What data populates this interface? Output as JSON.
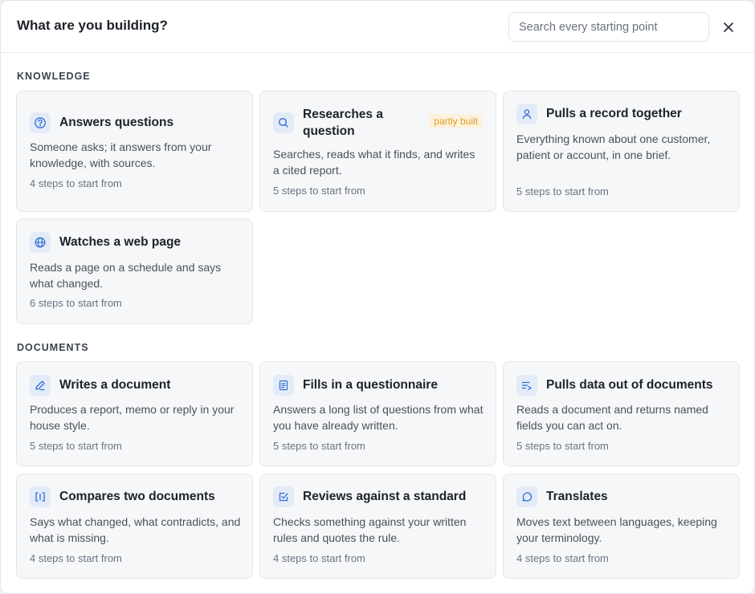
{
  "dialog": {
    "title": "What are you building?",
    "search_placeholder": "Search every starting point",
    "close_icon": "close-icon"
  },
  "sections": [
    {
      "label": "KNOWLEDGE",
      "cards": [
        {
          "title": "Answers questions",
          "description": "Someone asks; it answers from your knowledge, with sources.",
          "steps": "4 steps to start from",
          "icon": "question-circle-icon"
        },
        {
          "title": "Researches a question",
          "description": "Searches, reads what it finds, and writes a cited report.",
          "steps": "5 steps to start from",
          "icon": "search-icon",
          "badge": "partly built"
        },
        {
          "title": "Pulls a record together",
          "description": "Everything known about one customer, patient or account, in one brief.",
          "steps": "5 steps to start from",
          "icon": "user-icon"
        },
        {
          "title": "Watches a web page",
          "description": "Reads a page on a schedule and says what changed.",
          "steps": "6 steps to start from",
          "icon": "globe-icon"
        }
      ]
    },
    {
      "label": "DOCUMENTS",
      "cards": [
        {
          "title": "Writes a document",
          "description": "Produces a report, memo or reply in your house style.",
          "steps": "5 steps to start from",
          "icon": "pencil-icon"
        },
        {
          "title": "Fills in a questionnaire",
          "description": "Answers a long list of questions from what you have already written.",
          "steps": "5 steps to start from",
          "icon": "document-icon"
        },
        {
          "title": "Pulls data out of documents",
          "description": "Reads a document and returns named fields you can act on.",
          "steps": "5 steps to start from",
          "icon": "extract-lines-icon"
        },
        {
          "title": "Compares two documents",
          "description": "Says what changed, what contradicts, and what is missing.",
          "steps": "4 steps to start from",
          "icon": "compare-icon"
        },
        {
          "title": "Reviews against a standard",
          "description": "Checks something against your written rules and quotes the rule.",
          "steps": "4 steps to start from",
          "icon": "checkbox-icon"
        },
        {
          "title": "Translates",
          "description": "Moves text between languages, keeping your terminology.",
          "steps": "4 steps to start from",
          "icon": "speech-bubble-icon"
        }
      ]
    }
  ],
  "colors": {
    "icon_stroke": "#2f6fd1",
    "icon_bg": "#e4ebf8",
    "badge_bg": "#fdf1de",
    "badge_text": "#e39c26"
  }
}
